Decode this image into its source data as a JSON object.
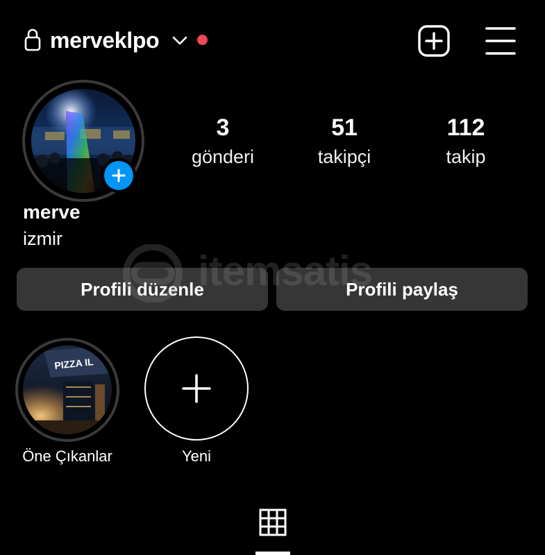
{
  "header": {
    "username": "merveklpo",
    "notification_color": "#ed4956"
  },
  "profile": {
    "display_name": "merve",
    "bio": "izmir",
    "add_story_color": "#0095f6"
  },
  "stats": [
    {
      "value": "3",
      "label": "gönderi"
    },
    {
      "value": "51",
      "label": "takipçi"
    },
    {
      "value": "112",
      "label": "takip"
    }
  ],
  "actions": {
    "edit_profile": "Profili düzenle",
    "share_profile": "Profili paylaş"
  },
  "highlights": [
    {
      "label": "Öne Çıkanlar"
    },
    {
      "label": "Yeni"
    }
  ],
  "watermark": {
    "text": "itemsatis"
  },
  "icons": {
    "lock": "lock-icon",
    "chevron": "chevron-down-icon",
    "new_post": "plus-square-icon",
    "menu": "hamburger-menu-icon",
    "add_story": "plus-circle-icon",
    "new_highlight": "plus-icon",
    "posts_tab": "grid-icon"
  }
}
